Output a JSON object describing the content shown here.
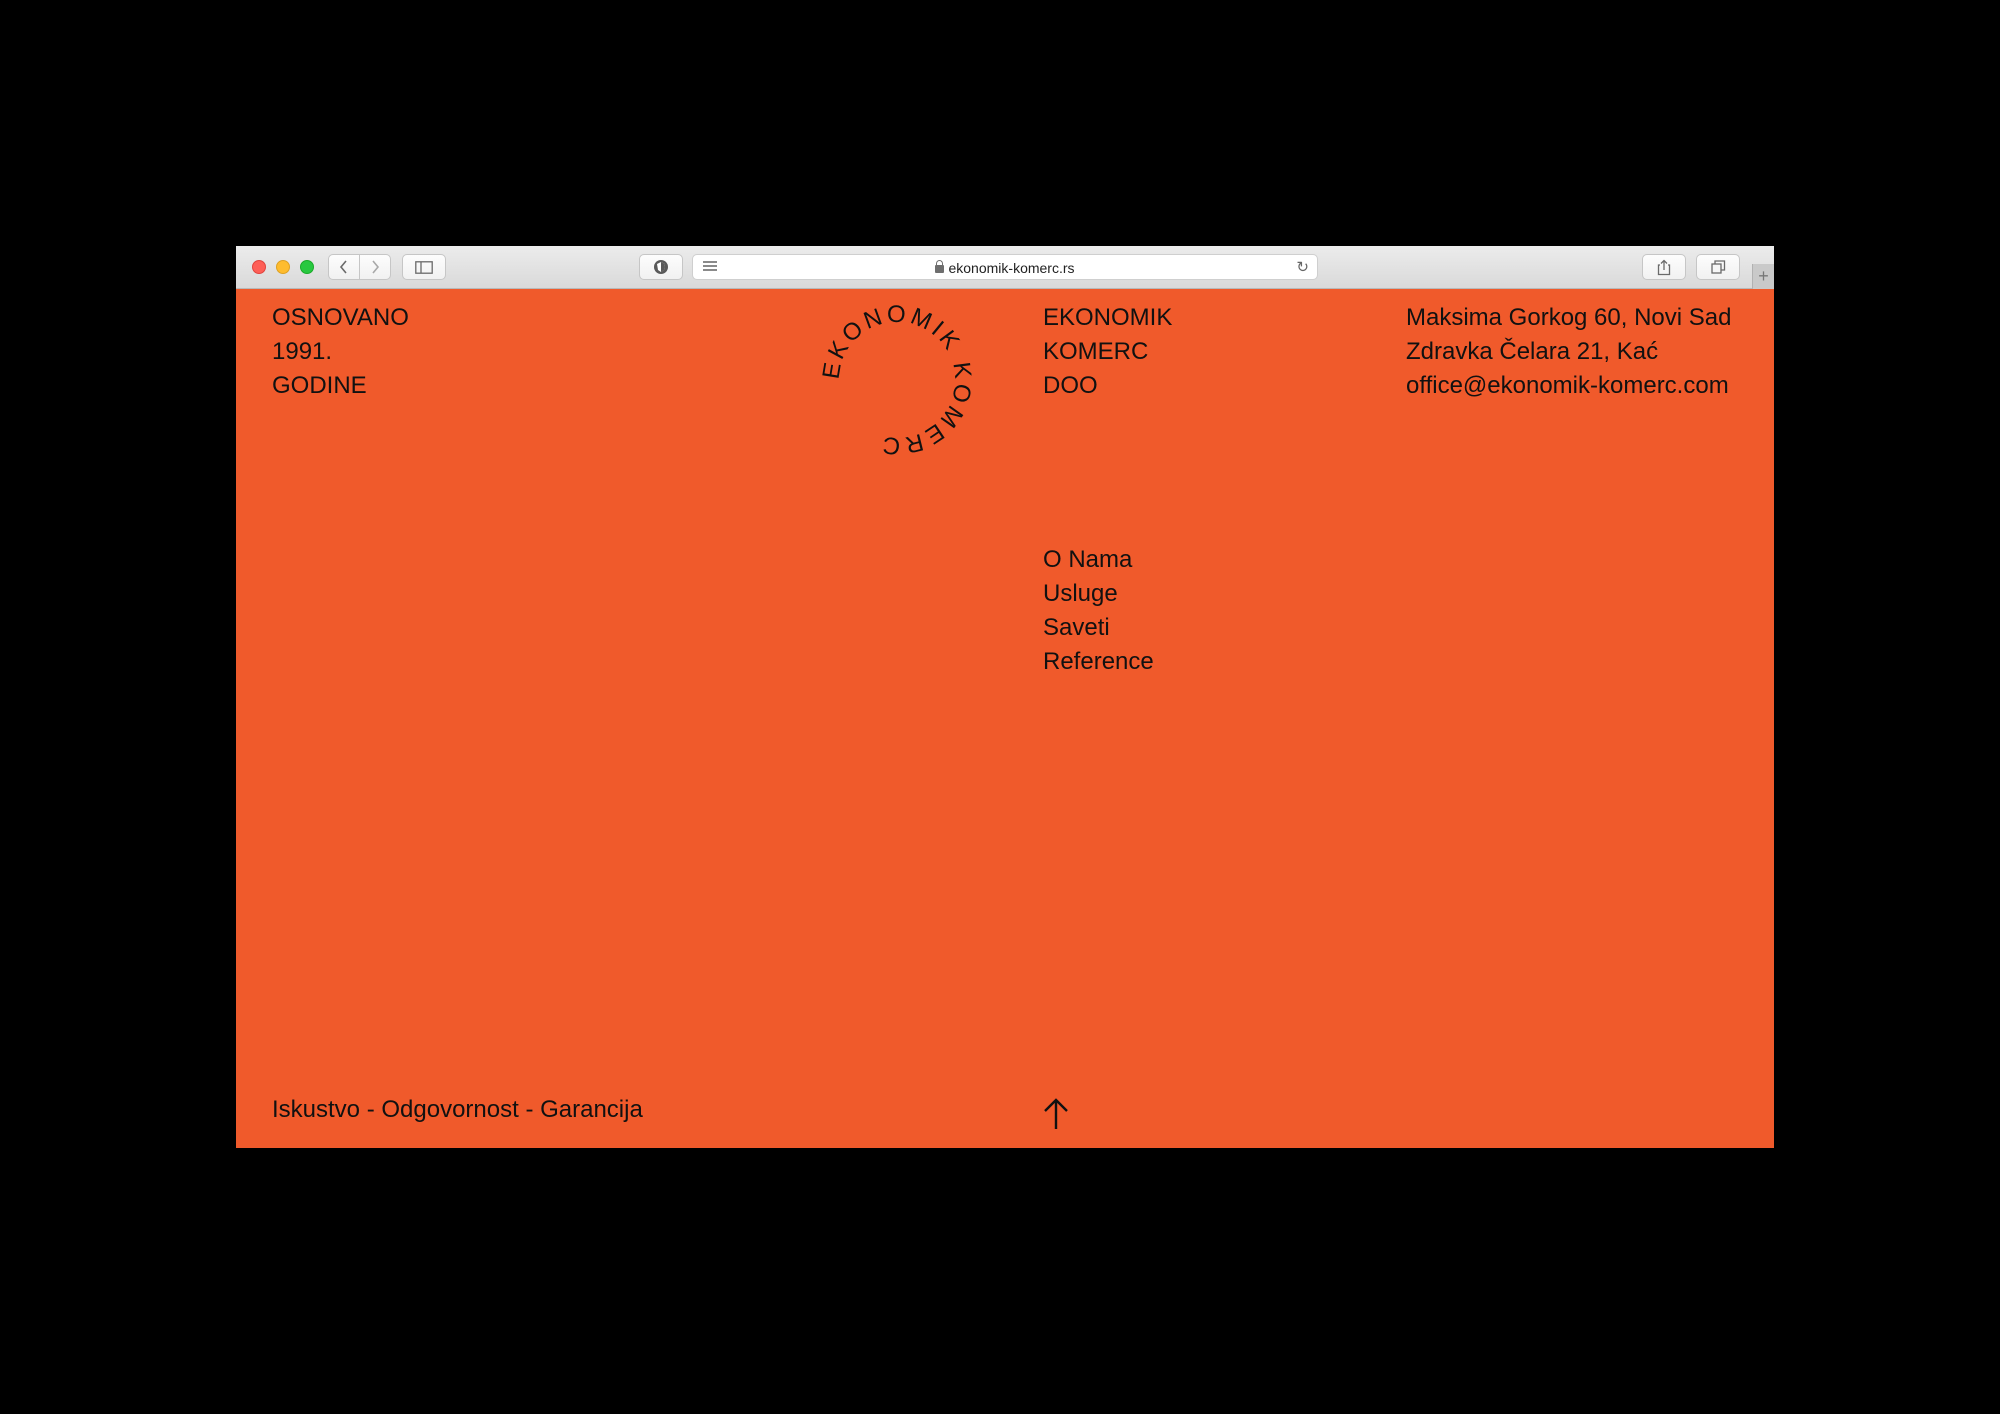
{
  "browser": {
    "url": "ekonomik-komerc.rs",
    "new_tab_label": "+"
  },
  "logo": {
    "ring_text": "EKONOMIK KOMERC"
  },
  "header": {
    "founded": [
      "OSNOVANO",
      "1991.",
      "GODINE"
    ],
    "company": [
      "EKONOMIK",
      "KOMERC",
      "DOO"
    ],
    "contact": {
      "address_1": "Maksima Gorkog 60, Novi Sad",
      "address_2": "Zdravka Čelara 21, Kać",
      "email": "office@ekonomik-komerc.com"
    }
  },
  "nav": {
    "items": [
      "O Nama",
      "Usluge",
      "Saveti",
      "Reference"
    ]
  },
  "footer": {
    "tagline": "Iskustvo - Odgovornost - Garancija"
  },
  "colors": {
    "page_background": "#f05a2b",
    "text": "#111111"
  },
  "icons": {
    "back": "chevron-left-icon",
    "forward": "chevron-right-icon",
    "sidebar": "sidebar-icon",
    "privacy": "shield-icon",
    "reader": "reader-icon",
    "reload": "reload-icon",
    "share": "share-icon",
    "tabs": "tabs-icon",
    "scroll_top": "arrow-up-icon"
  }
}
